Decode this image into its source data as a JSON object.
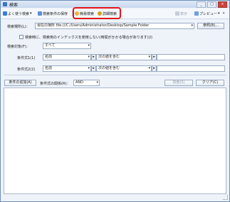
{
  "window": {
    "title": "検索",
    "buttons": [
      "_",
      "□",
      "×"
    ]
  },
  "toolbar": {
    "frequent_search": "よく使う検索",
    "save_conditions": "検索条件の保存",
    "simple_search": "簡易検索",
    "detail_search": "詳細検索",
    "display": "表示",
    "preview": "プレビュー",
    "colors": {
      "highlight": "#e0151b"
    }
  },
  "form": {
    "location_label": "検索場所(L)：",
    "location_value": "現在の場所 file:///C:/Users/Administrator/Desktop/Sample Folder",
    "browse_label": "参照(B)...",
    "index_checkbox_label": "検索時に、検索用のインデックスを使用しない(時間がかかる場合があります)(I)",
    "target_label": "検索対象(F)：",
    "target_value": "すべて",
    "cond1_label": "条件式1(1)",
    "cond1_field": "名前",
    "cond1_op": "次の値を含む",
    "cond1_value": "",
    "cond2_label": "条件式2(2)",
    "cond2_field": "名前",
    "cond2_op": "次の値を含む",
    "cond2_value": "",
    "add_condition": "条件の追加(A)",
    "combine_label": "条件式の関係(R)：",
    "combine_value": "AND",
    "search_button": "検索(S)",
    "clear_button": "クリア(C)"
  }
}
